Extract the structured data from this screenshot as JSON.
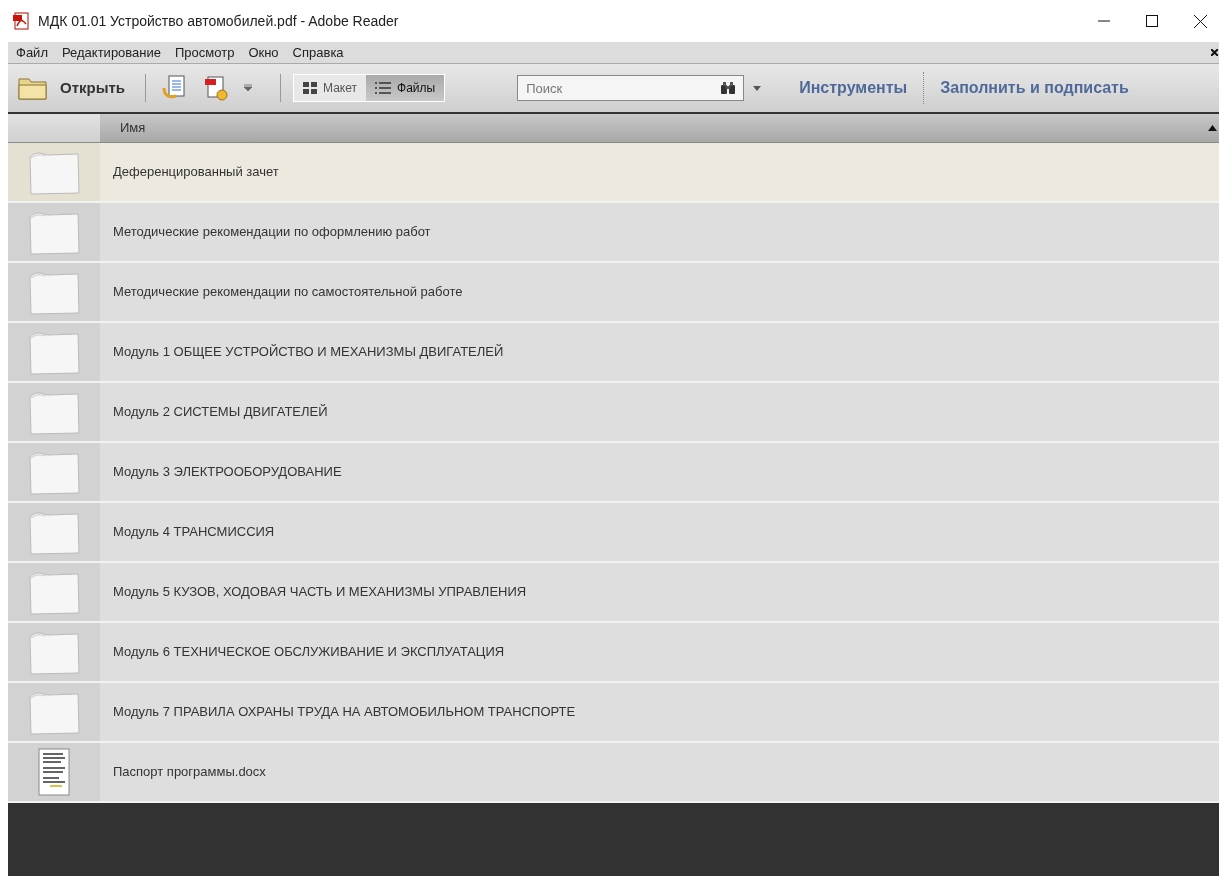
{
  "window": {
    "title": "МДК 01.01 Устройство автомобилей.pdf - Adobe Reader"
  },
  "menu": [
    "Файл",
    "Редактирование",
    "Просмотр",
    "Окно",
    "Справка"
  ],
  "toolbar": {
    "open_label": "Открыть",
    "views": [
      {
        "label": "Макет",
        "kind": "grid",
        "selected": false
      },
      {
        "label": "Файлы",
        "kind": "list",
        "selected": true
      }
    ],
    "search": {
      "placeholder": "Поиск"
    },
    "links": [
      "Инструменты",
      "Заполнить и подписать"
    ]
  },
  "table": {
    "columns": [
      "Имя"
    ],
    "rows": [
      {
        "name": "Деференцированный зачет",
        "kind": "folder",
        "selected": true
      },
      {
        "name": "Методические рекомендации по оформлению работ",
        "kind": "folder",
        "selected": false
      },
      {
        "name": "Методические рекомендации по самостоятельной работе",
        "kind": "folder",
        "selected": false
      },
      {
        "name": "Модуль 1 ОБЩЕЕ УСТРОЙСТВО И МЕХАНИЗМЫ ДВИГАТЕЛЕЙ",
        "kind": "folder",
        "selected": false
      },
      {
        "name": "Модуль 2 СИСТЕМЫ ДВИГАТЕЛЕЙ",
        "kind": "folder",
        "selected": false
      },
      {
        "name": "Модуль 3 ЭЛЕКТРООБОРУДОВАНИЕ",
        "kind": "folder",
        "selected": false
      },
      {
        "name": "Модуль 4 ТРАНСМИССИЯ",
        "kind": "folder",
        "selected": false
      },
      {
        "name": "Модуль 5 КУЗОВ, ХОДОВАЯ ЧАСТЬ И МЕХАНИЗМЫ УПРАВЛЕНИЯ",
        "kind": "folder",
        "selected": false
      },
      {
        "name": "Модуль 6 ТЕХНИЧЕСКОЕ ОБСЛУЖИВАНИЕ И ЭКСПЛУАТАЦИЯ",
        "kind": "folder",
        "selected": false
      },
      {
        "name": "Модуль 7 ПРАВИЛА ОХРАНЫ ТРУДА НА АВТОМОБИЛЬНОМ ТРАНСПОРТЕ",
        "kind": "folder",
        "selected": false
      },
      {
        "name": "Паспорт программы.docx",
        "kind": "document",
        "selected": false
      }
    ]
  }
}
